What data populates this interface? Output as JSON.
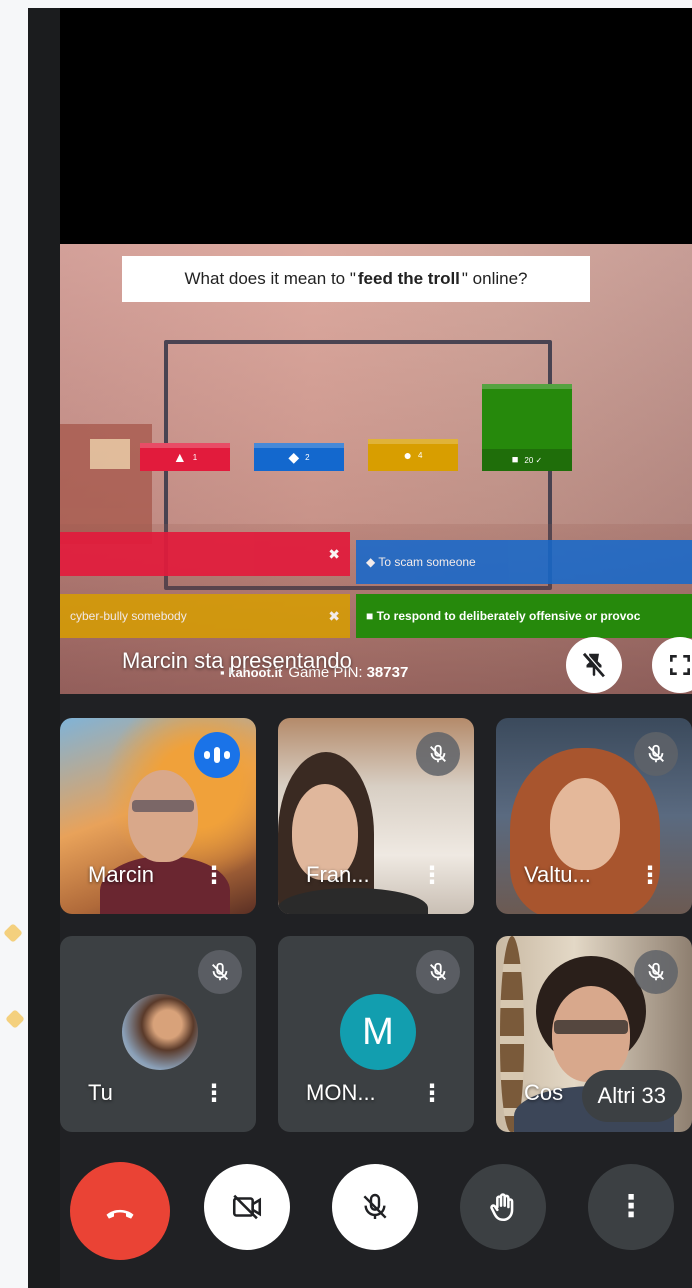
{
  "presentation": {
    "question_prefix": "What does it mean to \"",
    "question_bold": "feed the troll",
    "question_suffix": "\" online?",
    "bars": [
      {
        "symbol": "▲",
        "count": "1"
      },
      {
        "symbol": "◆",
        "count": "2"
      },
      {
        "symbol": "●",
        "count": "4"
      },
      {
        "symbol": "■",
        "count": "20 ✓"
      }
    ],
    "answers": {
      "red_mark": "✖",
      "blue_text": "◆ To scam someone",
      "gold_text": "cyber-bully somebody",
      "gold_mark": "✖",
      "green_text": "■ To respond to deliberately offensive or provoc"
    },
    "pin_site": "▪ kahoot.it",
    "pin_label": "Game PIN:",
    "pin_value": "38737",
    "presenting_text": "Marcin sta presentando"
  },
  "participants": [
    {
      "name": "Marcin",
      "menu": "⋮"
    },
    {
      "name": "Fran...",
      "menu": "⋮"
    },
    {
      "name": "Valtu...",
      "menu": "⋮"
    },
    {
      "name": "Tu",
      "menu": "⋮"
    },
    {
      "name": "MON...",
      "menu": "⋮",
      "initial": "M"
    },
    {
      "name": "Cos",
      "menu": ""
    }
  ],
  "others_label": "Altri 33",
  "controls": {
    "more": "⋮"
  },
  "colors": {
    "end_call": "#ea4335",
    "speaking": "#1a73e8",
    "avatar_m": "#129eaf"
  }
}
